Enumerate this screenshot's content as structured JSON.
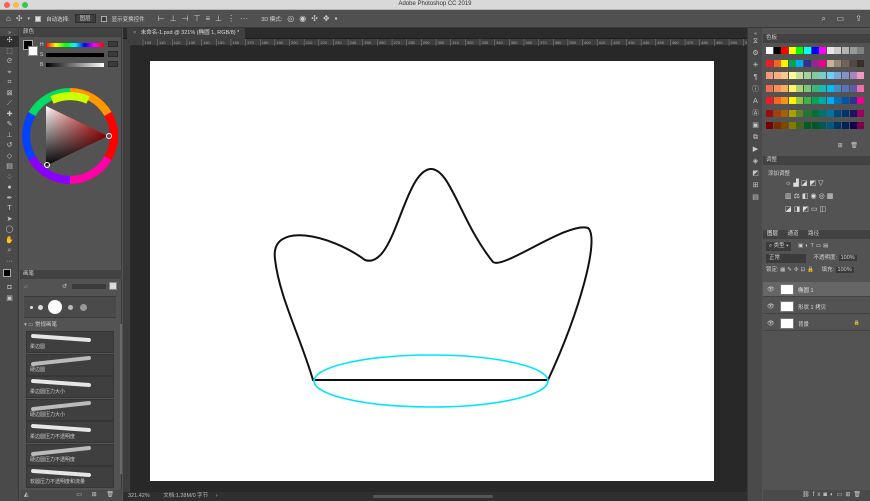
{
  "window": {
    "title": "Adobe Photoshop CC 2019"
  },
  "options_bar": {
    "auto_select_label": "自动选择:",
    "auto_select_value": "图层",
    "show_transform_label": "显示变换控件",
    "mode_3d_label": "3D 模式:"
  },
  "document": {
    "tab_label": "未命名-1.psd @ 321% (椭圆 1, RGB/8) *",
    "zoom_status": "321.42%",
    "doc_status": "文档:1.28M/0 字节",
    "ruler_numbers": [
      "100",
      "110",
      "120",
      "130",
      "140",
      "150",
      "160",
      "170",
      "180",
      "190",
      "200",
      "210",
      "220",
      "230",
      "240",
      "250",
      "260",
      "270",
      "280",
      "290",
      "300",
      "310",
      "320",
      "330",
      "340",
      "350",
      "360",
      "370",
      "380",
      "390",
      "400",
      "410",
      "420",
      "430",
      "440",
      "450",
      "460",
      "470",
      "480",
      "490",
      "500",
      "510",
      "520"
    ]
  },
  "left_panels": {
    "color_tab": "颜色",
    "brush_tab": "画笔",
    "brush_group": "常规画笔",
    "channel_labels": [
      "H",
      "S",
      "B"
    ],
    "brushes": [
      {
        "label": "柔边圆"
      },
      {
        "label": "硬边圆"
      },
      {
        "label": "柔边圆压力大小"
      },
      {
        "label": "硬边圆压力大小"
      },
      {
        "label": "柔边圆压力不透明度"
      },
      {
        "label": "硬边圆压力不透明度"
      },
      {
        "label": "软圆压力不透明度和流量"
      }
    ]
  },
  "right_panels": {
    "swatches_tab": "色板",
    "adjustments_tab": "调整",
    "adjustments_add": "添加调整",
    "layers_tabs": [
      "图层",
      "通道",
      "路径"
    ],
    "kind_label": "类型",
    "blend_mode": "正常",
    "opacity_label": "不透明度:",
    "opacity_value": "100%",
    "lock_label": "锁定:",
    "fill_label": "填充:",
    "fill_value": "100%",
    "layers": [
      {
        "name": "椭圆 1"
      },
      {
        "name": "形状 1 拷贝"
      },
      {
        "name": "背景"
      }
    ]
  },
  "colors": {
    "selection_outline": "#00e5ff",
    "crown_stroke": "#111111",
    "accent": "#2d8cff"
  },
  "swatch_colors": [
    "#ffffff",
    "#000000",
    "#ff0000",
    "#ffff00",
    "#00ff00",
    "#00ffff",
    "#0000ff",
    "#ff00ff",
    "#e6e6e6",
    "#cccccc",
    "#b3b3b3",
    "#999999",
    "#808080",
    "#ee1c25",
    "#f26522",
    "#fff200",
    "#00a651",
    "#00aeef",
    "#2e3192",
    "#92278f",
    "#ec008c",
    "#c7b299",
    "#998675",
    "#736357",
    "#534741",
    "#362f2d",
    "#f7977a",
    "#f9ad81",
    "#fdc68a",
    "#fff79a",
    "#c4df9b",
    "#a3d39c",
    "#82ca9d",
    "#7accc8",
    "#6dcff6",
    "#7da7d9",
    "#8393ca",
    "#a187be",
    "#f49ac2",
    "#f26c4f",
    "#f68e55",
    "#fbaf5c",
    "#fff467",
    "#acd372",
    "#7cc576",
    "#3bb878",
    "#1abbb4",
    "#00bff3",
    "#438cca",
    "#5574b9",
    "#605ca8",
    "#f06eaa",
    "#ed1c24",
    "#f26522",
    "#f7941d",
    "#fff200",
    "#8dc73f",
    "#39b54a",
    "#00a651",
    "#00a99d",
    "#00aeef",
    "#0072bc",
    "#0054a6",
    "#2e3192",
    "#ec008c",
    "#9e0b0f",
    "#a0410d",
    "#a36209",
    "#aba000",
    "#598527",
    "#1a7b30",
    "#007236",
    "#00746b",
    "#0076a3",
    "#004a80",
    "#003471",
    "#1b1464",
    "#9e005d",
    "#790000",
    "#7b2e00",
    "#7d4900",
    "#827b00",
    "#406618",
    "#005e20",
    "#005826",
    "#005952",
    "#005b7f",
    "#003663",
    "#002157",
    "#0d004c",
    "#7b0046"
  ]
}
